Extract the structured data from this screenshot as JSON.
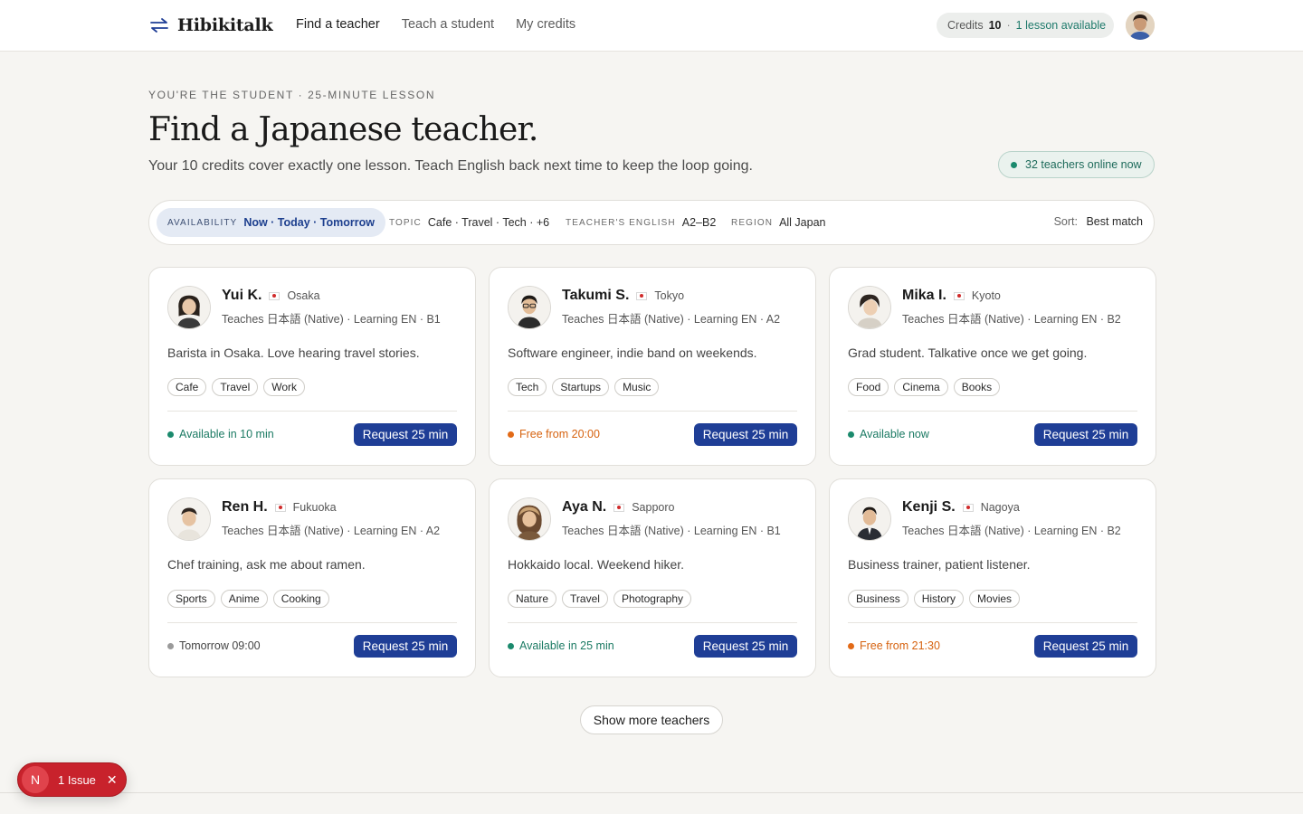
{
  "header": {
    "brand": "Hibikitalk",
    "nav": [
      {
        "label": "Find a teacher"
      },
      {
        "label": "Teach a student"
      },
      {
        "label": "My credits"
      }
    ],
    "credits_label": "Credits",
    "credits_value": "10",
    "credits_sep": "·",
    "credits_note": "1 lesson available"
  },
  "hero": {
    "eyebrow": "You're the student · 25-minute lesson",
    "title": "Find a Japanese teacher.",
    "subtitle": "Your 10 credits cover exactly one lesson. Teach English back next time to keep the loop going.",
    "online": "32 teachers online now"
  },
  "filters": {
    "availability": {
      "key": "Availability",
      "value": "Now · Today · Tomorrow"
    },
    "topic": {
      "key": "Topic",
      "value": "Cafe · Travel · Tech · +6"
    },
    "english": {
      "key": "Teacher's English",
      "value": "A2–B2"
    },
    "region": {
      "key": "Region",
      "value": "All Japan"
    },
    "sort_label": "Sort:",
    "sort_value": "Best match"
  },
  "teachers": [
    {
      "name": "Yui K.",
      "city": "Osaka",
      "lang": "Teaches 日本語 (Native) · Learning EN · B1",
      "bio": "Barista in Osaka. Love hearing travel stories.",
      "tags": [
        "Cafe",
        "Travel",
        "Work"
      ],
      "availability": "Available in 10 min",
      "status": "green",
      "cta": "Request 25 min"
    },
    {
      "name": "Takumi S.",
      "city": "Tokyo",
      "lang": "Teaches 日本語 (Native) · Learning EN · A2",
      "bio": "Software engineer, indie band on weekends.",
      "tags": [
        "Tech",
        "Startups",
        "Music"
      ],
      "availability": "Free from 20:00",
      "status": "orange",
      "cta": "Request 25 min"
    },
    {
      "name": "Mika I.",
      "city": "Kyoto",
      "lang": "Teaches 日本語 (Native) · Learning EN · B2",
      "bio": "Grad student. Talkative once we get going.",
      "tags": [
        "Food",
        "Cinema",
        "Books"
      ],
      "availability": "Available now",
      "status": "green",
      "cta": "Request 25 min"
    },
    {
      "name": "Ren H.",
      "city": "Fukuoka",
      "lang": "Teaches 日本語 (Native) · Learning EN · A2",
      "bio": "Chef training, ask me about ramen.",
      "tags": [
        "Sports",
        "Anime",
        "Cooking"
      ],
      "availability": "Tomorrow 09:00",
      "status": "gray",
      "cta": "Request 25 min"
    },
    {
      "name": "Aya N.",
      "city": "Sapporo",
      "lang": "Teaches 日本語 (Native) · Learning EN · B1",
      "bio": "Hokkaido local. Weekend hiker.",
      "tags": [
        "Nature",
        "Travel",
        "Photography"
      ],
      "availability": "Available in 25 min",
      "status": "green",
      "cta": "Request 25 min"
    },
    {
      "name": "Kenji S.",
      "city": "Nagoya",
      "lang": "Teaches 日本語 (Native) · Learning EN · B2",
      "bio": "Business trainer, patient listener.",
      "tags": [
        "Business",
        "History",
        "Movies"
      ],
      "availability": "Free from 21:30",
      "status": "orange",
      "cta": "Request 25 min"
    }
  ],
  "show_more": "Show more teachers",
  "issue": {
    "initial": "N",
    "text": "1 Issue",
    "close": "✕"
  },
  "colors": {
    "accent": "#1f3e96",
    "available": "#1b8a6d",
    "later": "#e26a17",
    "issue": "#c8222c"
  }
}
